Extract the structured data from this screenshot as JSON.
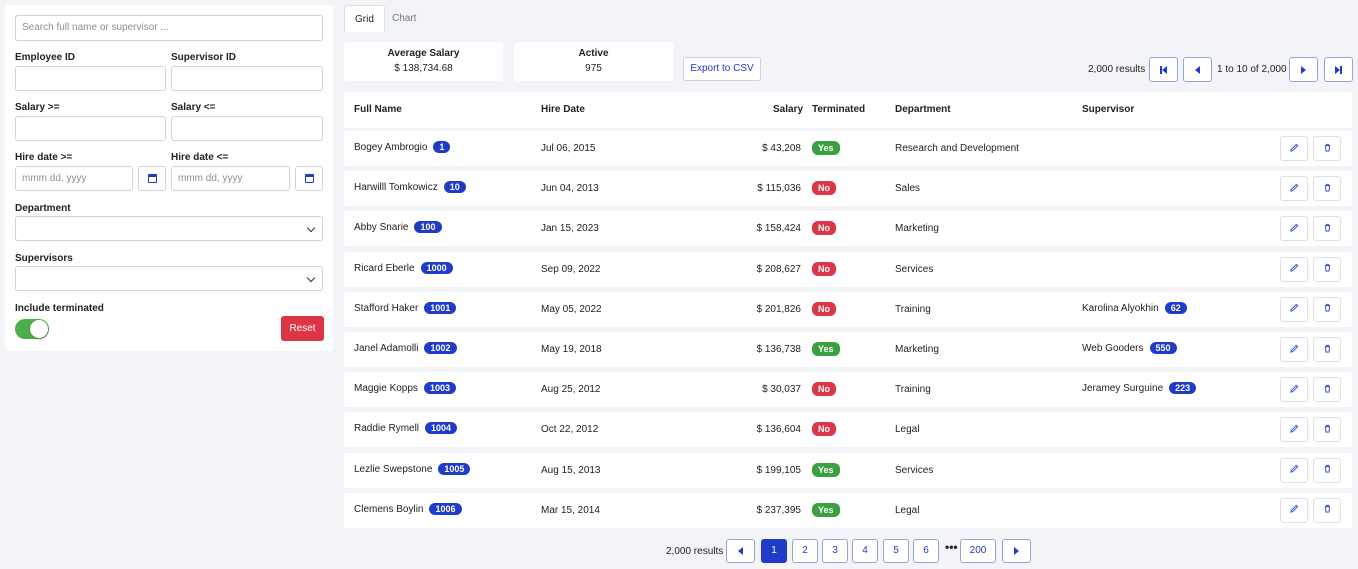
{
  "filters": {
    "search_placeholder": "Search full name or supervisor ...",
    "employee_id_label": "Employee ID",
    "supervisor_id_label": "Supervisor ID",
    "salary_min_label": "Salary >=",
    "salary_max_label": "Salary <=",
    "hire_min_label": "Hire date >=",
    "hire_max_label": "Hire date <=",
    "date_placeholder": "mmm dd, yyyy",
    "department_label": "Department",
    "supervisors_label": "Supervisors",
    "include_terminated_label": "Include terminated",
    "include_terminated": true,
    "reset_label": "Reset"
  },
  "tabs": [
    "Grid",
    "Chart"
  ],
  "stats": {
    "avg_salary_title": "Average Salary",
    "avg_salary_value": "$ 138,734.68",
    "active_title": "Active",
    "active_value": "975"
  },
  "export_label": "Export to CSV",
  "pagination_top": {
    "results": "2,000 results",
    "range": "1 to 10 of 2,000"
  },
  "columns": [
    "Full Name",
    "Hire Date",
    "Salary",
    "Terminated",
    "Department",
    "Supervisor"
  ],
  "rows": [
    {
      "name": "Bogey Ambrogio",
      "id": "1",
      "hire": "Jul 06, 2015",
      "salary": "$ 43,208",
      "term": "Yes",
      "dept": "Research and Development",
      "sup": "",
      "sup_id": ""
    },
    {
      "name": "Harwilll Tomkowicz",
      "id": "10",
      "hire": "Jun 04, 2013",
      "salary": "$ 115,036",
      "term": "No",
      "dept": "Sales",
      "sup": "",
      "sup_id": ""
    },
    {
      "name": "Abby Snarie",
      "id": "100",
      "hire": "Jan 15, 2023",
      "salary": "$ 158,424",
      "term": "No",
      "dept": "Marketing",
      "sup": "",
      "sup_id": ""
    },
    {
      "name": "Ricard Eberle",
      "id": "1000",
      "hire": "Sep 09, 2022",
      "salary": "$ 208,627",
      "term": "No",
      "dept": "Services",
      "sup": "",
      "sup_id": ""
    },
    {
      "name": "Stafford Haker",
      "id": "1001",
      "hire": "May 05, 2022",
      "salary": "$ 201,826",
      "term": "No",
      "dept": "Training",
      "sup": "Karolina Alyokhin",
      "sup_id": "62"
    },
    {
      "name": "Janel Adamolli",
      "id": "1002",
      "hire": "May 19, 2018",
      "salary": "$ 136,738",
      "term": "Yes",
      "dept": "Marketing",
      "sup": "Web Gooders",
      "sup_id": "550"
    },
    {
      "name": "Maggie Kopps",
      "id": "1003",
      "hire": "Aug 25, 2012",
      "salary": "$ 30,037",
      "term": "No",
      "dept": "Training",
      "sup": "Jeramey Surguine",
      "sup_id": "223"
    },
    {
      "name": "Raddie Rymell",
      "id": "1004",
      "hire": "Oct 22, 2012",
      "salary": "$ 136,604",
      "term": "No",
      "dept": "Legal",
      "sup": "",
      "sup_id": ""
    },
    {
      "name": "Lezlie Swepstone",
      "id": "1005",
      "hire": "Aug 15, 2013",
      "salary": "$ 199,105",
      "term": "Yes",
      "dept": "Services",
      "sup": "",
      "sup_id": ""
    },
    {
      "name": "Clemens Boylin",
      "id": "1006",
      "hire": "Mar 15, 2014",
      "salary": "$ 237,395",
      "term": "Yes",
      "dept": "Legal",
      "sup": "",
      "sup_id": ""
    }
  ],
  "pagination_bottom": {
    "results": "2,000 results",
    "pages": [
      "1",
      "2",
      "3",
      "4",
      "5",
      "6"
    ],
    "ellipsis": "•••",
    "last": "200"
  }
}
